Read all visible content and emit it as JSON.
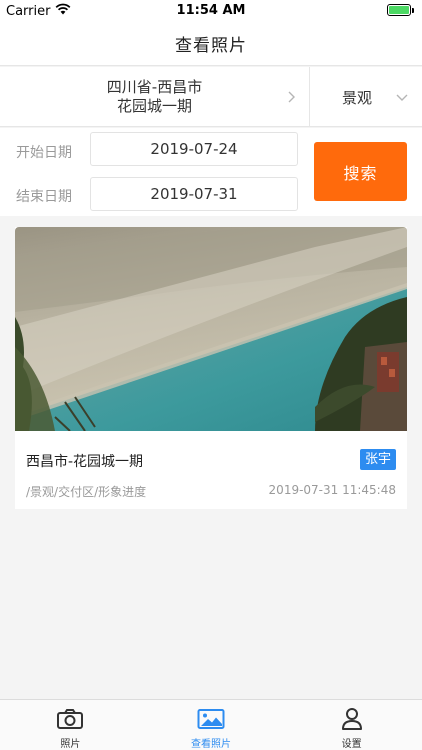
{
  "status_bar": {
    "carrier": "Carrier",
    "time": "11:54 AM",
    "wifi_icon": "wifi-icon",
    "battery_icon": "battery-icon",
    "battery_level": 1.0,
    "battery_color": "#4cd964"
  },
  "nav": {
    "title": "查看照片"
  },
  "filter": {
    "location_line1": "四川省-西昌市",
    "location_line2": "花园城一期",
    "location_chevron_icon": "chevron-right-icon",
    "category": "景观",
    "category_chevron_icon": "chevron-down-icon"
  },
  "dates": {
    "start_label": "开始日期",
    "start_value": "2019-07-24",
    "end_label": "结束日期",
    "end_value": "2019-07-31"
  },
  "search": {
    "label": "搜索",
    "color": "#ff6a0c"
  },
  "photos": [
    {
      "title": "西昌市-花园城一期",
      "user": "张宇",
      "path": "/景观/交付区/形象进度",
      "time": "2019-07-31 11:45:48"
    }
  ],
  "tabs": [
    {
      "label": "照片",
      "icon": "camera-icon",
      "active": false
    },
    {
      "label": "查看照片",
      "icon": "image-icon",
      "active": true
    },
    {
      "label": "设置",
      "icon": "person-icon",
      "active": false
    }
  ],
  "colors": {
    "accent": "#2d8cf0",
    "search": "#ff6a0c",
    "badge": "#2d8cf0"
  }
}
